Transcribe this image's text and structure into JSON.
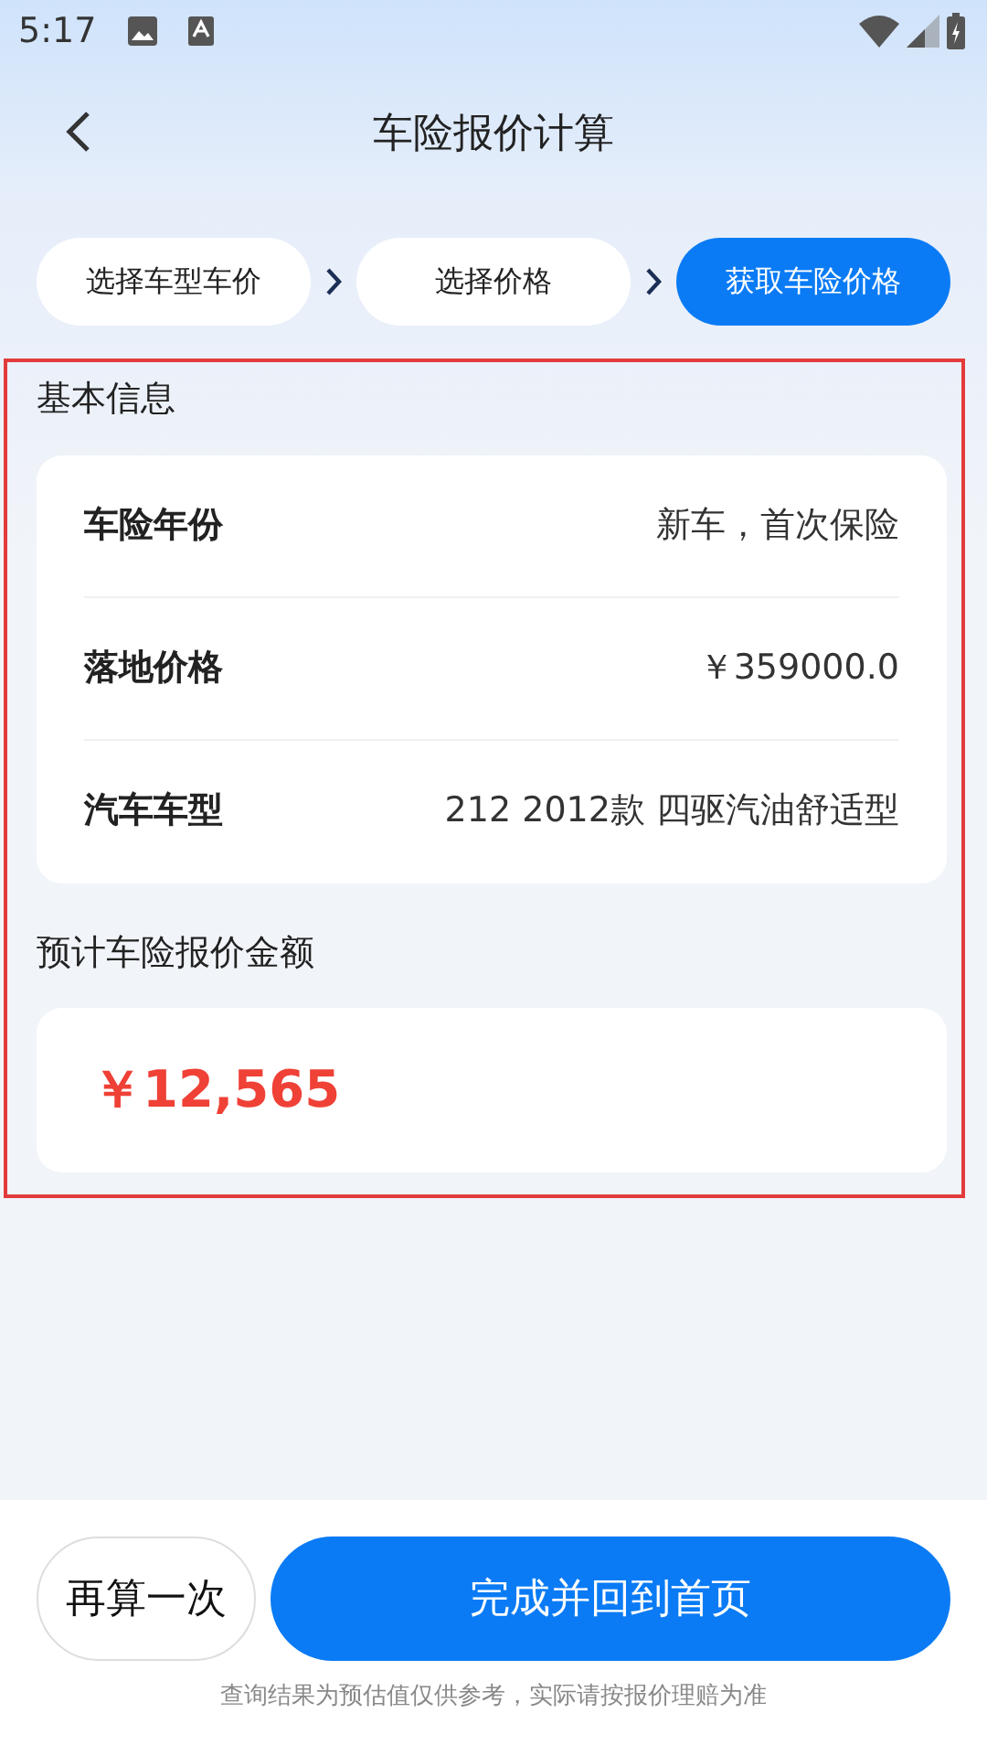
{
  "status_bar": {
    "time": "5:17"
  },
  "header": {
    "title": "车险报价计算"
  },
  "steps": [
    {
      "label": "选择车型车价",
      "selected": false
    },
    {
      "label": "选择价格",
      "selected": false
    },
    {
      "label": "获取车险价格",
      "selected": true
    }
  ],
  "basic_info": {
    "title": "基本信息",
    "rows": [
      {
        "label": "车险年份",
        "value": "新车，首次保险"
      },
      {
        "label": "落地价格",
        "value": "￥359000.0"
      },
      {
        "label": "汽车车型",
        "value": "212 2012款 四驱汽油舒适型"
      }
    ]
  },
  "estimate": {
    "title": "预计车险报价金额",
    "amount": "￥12,565"
  },
  "footer": {
    "buttons": [
      {
        "label": "再算一次",
        "kind": "secondary"
      },
      {
        "label": "完成并回到首页",
        "kind": "primary"
      }
    ],
    "note": "查询结果为预估值仅供参考，实际请按报价理赔为准"
  }
}
